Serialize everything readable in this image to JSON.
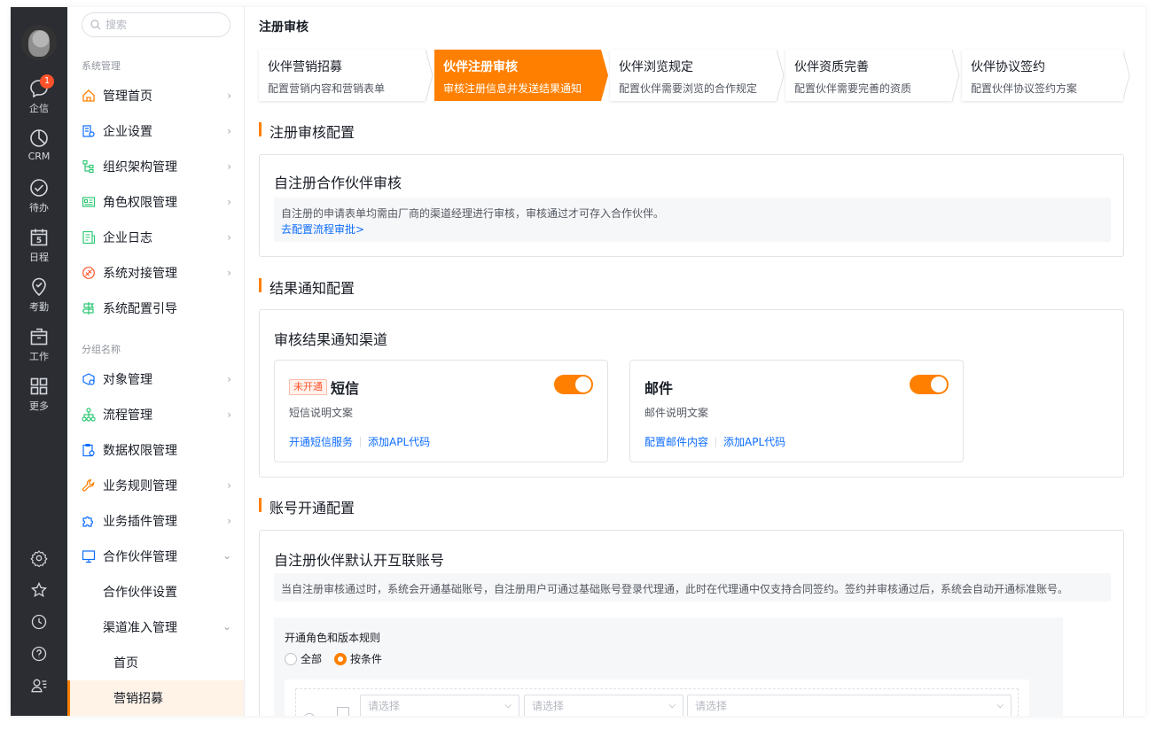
{
  "rail": {
    "badge": "1",
    "items": [
      {
        "label": "企信",
        "icon": "chat-icon"
      },
      {
        "label": "CRM",
        "icon": "pie-chart-icon"
      },
      {
        "label": "待办",
        "icon": "check-circle-icon"
      },
      {
        "label": "日程",
        "icon": "calendar-icon",
        "day": "5"
      },
      {
        "label": "考勤",
        "icon": "location-check-icon"
      },
      {
        "label": "工作",
        "icon": "briefcase-icon"
      },
      {
        "label": "更多",
        "icon": "grid-icon"
      }
    ],
    "bottom_icons": [
      "settings-icon",
      "star-icon",
      "clock-icon",
      "help-icon",
      "user-list-icon"
    ]
  },
  "nav": {
    "search_placeholder": "搜索",
    "group1": "系统管理",
    "group2": "分组名称",
    "items": [
      {
        "label": "管理首页",
        "icon": "home-icon"
      },
      {
        "label": "企业设置",
        "icon": "building-icon"
      },
      {
        "label": "组织架构管理",
        "icon": "org-tree-icon"
      },
      {
        "label": "角色权限管理",
        "icon": "id-card-icon"
      },
      {
        "label": "企业日志",
        "icon": "log-icon"
      },
      {
        "label": "系统对接管理",
        "icon": "connect-icon"
      },
      {
        "label": "系统配置引导",
        "icon": "signpost-icon"
      },
      {
        "label": "对象管理",
        "icon": "object-icon"
      },
      {
        "label": "流程管理",
        "icon": "flow-icon"
      },
      {
        "label": "数据权限管理",
        "icon": "data-permission-icon"
      },
      {
        "label": "业务规则管理",
        "icon": "wrench-icon"
      },
      {
        "label": "业务插件管理",
        "icon": "puzzle-icon"
      },
      {
        "label": "合作伙伴管理",
        "icon": "monitor-icon"
      }
    ],
    "sub": {
      "partner_settings": "合作伙伴设置",
      "channel_access": "渠道准入管理",
      "home": "首页",
      "marketing": "营销招募"
    }
  },
  "main": {
    "page_title": "注册审核",
    "steps": [
      {
        "title": "伙伴营销招募",
        "desc": "配置营销内容和营销表单"
      },
      {
        "title": "伙伴注册审核",
        "desc": "审核注册信息并发送结果通知"
      },
      {
        "title": "伙伴浏览规定",
        "desc": "配置伙伴需要浏览的合作规定"
      },
      {
        "title": "伙伴资质完善",
        "desc": "配置伙伴需要完善的资质"
      },
      {
        "title": "伙伴协议签约",
        "desc": "配置伙伴协议签约方案"
      }
    ],
    "sec1": {
      "title": "注册审核配置",
      "card_title": "自注册合作伙伴审核",
      "note": "自注册的申请表单均需由厂商的渠道经理进行审核，审核通过才可存入合作伙伴。",
      "link": "去配置流程审批>"
    },
    "sec2": {
      "title": "结果通知配置",
      "card_title": "审核结果通知渠道",
      "sms": {
        "tag": "未开通",
        "name": "短信",
        "desc": "短信说明文案",
        "link1": "开通短信服务",
        "link2": "添加APL代码"
      },
      "mail": {
        "name": "邮件",
        "desc": "邮件说明文案",
        "link1": "配置邮件内容",
        "link2": "添加APL代码"
      }
    },
    "sec3": {
      "title": "账号开通配置",
      "card_title": "自注册伙伴默认开互联账号",
      "note": "当自注册审核通过时，系统会开通基础账号，自注册用户可通过基础账号登录代理通，此时在代理通中仅支持合同签约。签约并审核通过后，系统会自动开通标准账号。",
      "rule_label": "开通角色和版本规则",
      "radio_all": "全部",
      "radio_cond": "按条件",
      "select_placeholder": "请选择"
    }
  },
  "colors": {
    "accent": "#ff8000",
    "link": "#0c6cff",
    "rail": "#2b2d33"
  }
}
